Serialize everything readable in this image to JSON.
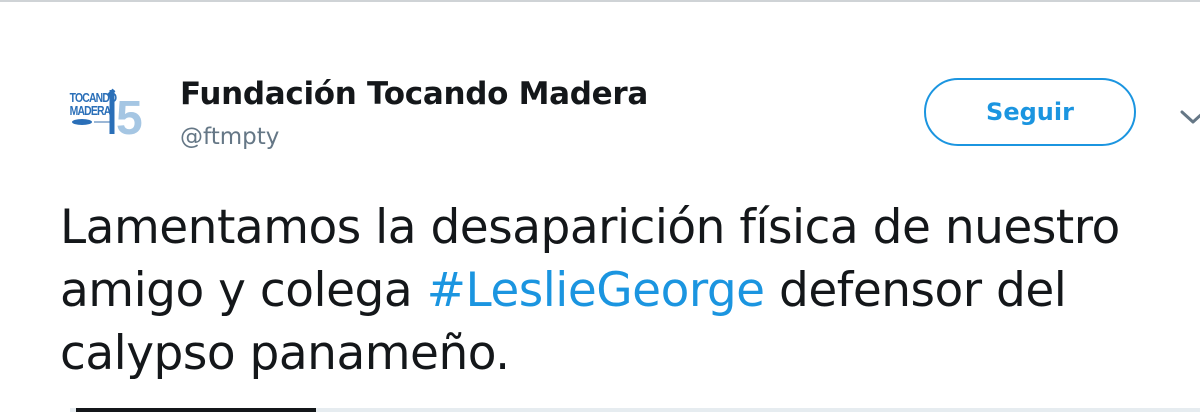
{
  "tweet": {
    "author": {
      "display_name": "Fundación Tocando Madera",
      "handle": "@ftmpty",
      "avatar_icon": "ftm-15-anniversary-logo",
      "avatar_logo_text": "Tocando Madera",
      "avatar_logo_number": "15"
    },
    "follow_label": "Seguir",
    "menu_icon": "chevron-down-icon",
    "text": {
      "line1": "Lamentamos la desaparición física de nuestro",
      "line2_before": "amigo y colega ",
      "hashtag": "#LeslieGeorge",
      "line2_after": " defensor del",
      "line3": "calypso panameño."
    }
  },
  "colors": {
    "accent": "#1b95e0",
    "text": "#14171a",
    "muted": "#657786",
    "logo_blue": "#2a6fb8"
  }
}
